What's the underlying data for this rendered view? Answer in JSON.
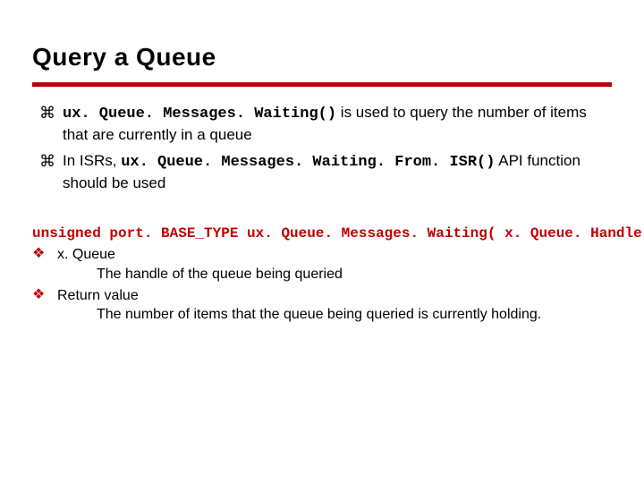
{
  "title": "Query a Queue",
  "glyphs": {
    "z": "⌘",
    "d": "❖"
  },
  "bullets": [
    {
      "code": "ux. Queue. Messages. Waiting()",
      "text": " is used to query the number of items that are currently in a queue"
    },
    {
      "lead": "In ISRs, ",
      "code": "ux. Queue. Messages. Waiting. From. ISR()",
      "text": " API function should be used"
    }
  ],
  "signature": "unsigned port. BASE_TYPE ux. Queue. Messages. Waiting( x. Queue. Handle x. Queue );",
  "params": [
    {
      "name": "x. Queue",
      "desc": "The handle of the queue being queried"
    },
    {
      "name": "Return value",
      "desc": "The number of items that the queue being queried is currently holding."
    }
  ]
}
